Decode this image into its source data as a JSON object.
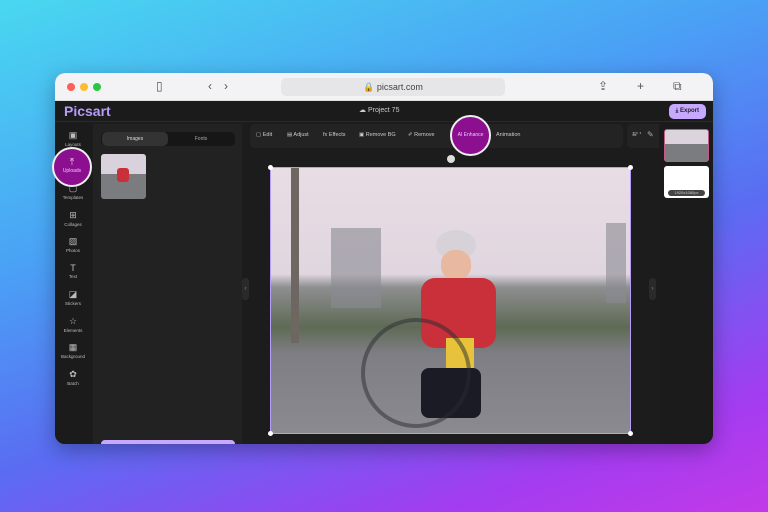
{
  "browser": {
    "url": "picsart.com"
  },
  "app": {
    "logo": "Picsart",
    "project": "Project 75",
    "export": "Export"
  },
  "rail": [
    {
      "label": "Layouts",
      "icon": "layout-icon"
    },
    {
      "label": "Uploads",
      "icon": "upload-icon"
    },
    {
      "label": "Templates",
      "icon": "templates-icon"
    },
    {
      "label": "Collages",
      "icon": "collage-icon"
    },
    {
      "label": "Photos",
      "icon": "photo-icon"
    },
    {
      "label": "Text",
      "icon": "text-icon"
    },
    {
      "label": "Stickers",
      "icon": "sticker-icon"
    },
    {
      "label": "Elements",
      "icon": "star-icon"
    },
    {
      "label": "Background",
      "icon": "background-icon"
    },
    {
      "label": "Batch",
      "icon": "batch-icon"
    }
  ],
  "panel": {
    "tabs": [
      "Images",
      "Fonts"
    ]
  },
  "toolbar": [
    "Edit",
    "Adjust",
    "Effects",
    "Remove BG",
    "Remove",
    "AI Enhance",
    "Animation"
  ],
  "right": {
    "page_label": "1920x1080px"
  },
  "colors": {
    "accent": "#c6a9ff",
    "highlight": "#8b0f8e"
  }
}
